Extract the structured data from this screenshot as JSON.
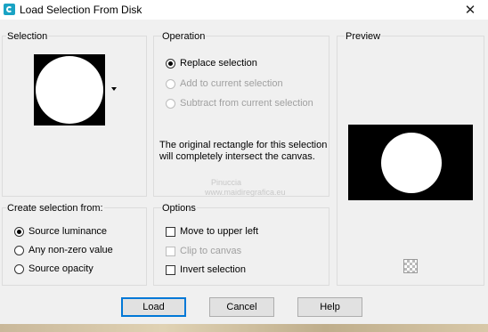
{
  "window": {
    "title": "Load Selection From Disk",
    "close_glyph": "✕"
  },
  "selection": {
    "title": "Selection"
  },
  "operation": {
    "title": "Operation",
    "options": [
      {
        "label": "Replace selection",
        "checked": true,
        "disabled": false
      },
      {
        "label": "Add to current selection",
        "checked": false,
        "disabled": true
      },
      {
        "label": "Subtract from current selection",
        "checked": false,
        "disabled": true
      }
    ],
    "description": "The original rectangle for this selection will completely intersect the canvas."
  },
  "preview": {
    "title": "Preview"
  },
  "create_from": {
    "title": "Create selection from:",
    "options": [
      {
        "label": "Source luminance",
        "checked": true
      },
      {
        "label": "Any non-zero value",
        "checked": false
      },
      {
        "label": "Source opacity",
        "checked": false
      }
    ]
  },
  "options": {
    "title": "Options",
    "items": [
      {
        "label": "Move to upper left",
        "checked": false,
        "disabled": false
      },
      {
        "label": "Clip to canvas",
        "checked": false,
        "disabled": true
      },
      {
        "label": "Invert selection",
        "checked": false,
        "disabled": false
      }
    ]
  },
  "buttons": {
    "load": "Load",
    "cancel": "Cancel",
    "help": "Help"
  },
  "watermark": {
    "line1": "Pinuccia",
    "line2": "www.maidiregrafica.eu"
  }
}
